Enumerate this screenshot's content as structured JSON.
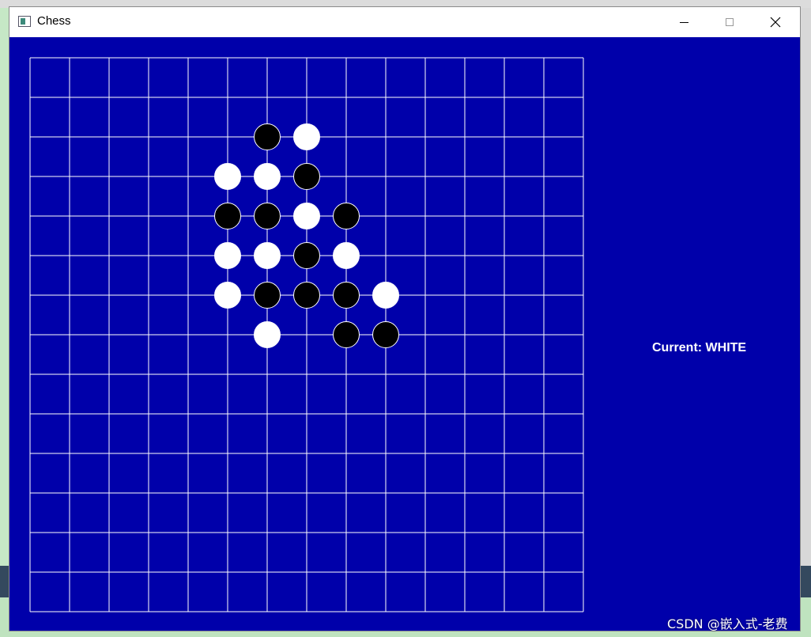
{
  "window": {
    "title": "Chess",
    "icon": "app-window-icon",
    "controls": {
      "minimize_icon": "minimize-icon",
      "maximize_icon": "maximize-icon",
      "close_icon": "close-icon"
    }
  },
  "colors": {
    "board_background": "#0000AA",
    "grid_line": "#FFFFFF",
    "black_stone": "#000000",
    "white_stone": "#FFFFFF"
  },
  "board": {
    "columns": 15,
    "rows": 15,
    "stones": [
      {
        "col": 6,
        "row": 2,
        "color": "black"
      },
      {
        "col": 7,
        "row": 2,
        "color": "white"
      },
      {
        "col": 5,
        "row": 3,
        "color": "white"
      },
      {
        "col": 6,
        "row": 3,
        "color": "white"
      },
      {
        "col": 7,
        "row": 3,
        "color": "black"
      },
      {
        "col": 5,
        "row": 4,
        "color": "black"
      },
      {
        "col": 6,
        "row": 4,
        "color": "black"
      },
      {
        "col": 7,
        "row": 4,
        "color": "white"
      },
      {
        "col": 8,
        "row": 4,
        "color": "black"
      },
      {
        "col": 5,
        "row": 5,
        "color": "white"
      },
      {
        "col": 6,
        "row": 5,
        "color": "white"
      },
      {
        "col": 7,
        "row": 5,
        "color": "black"
      },
      {
        "col": 8,
        "row": 5,
        "color": "white"
      },
      {
        "col": 5,
        "row": 6,
        "color": "white"
      },
      {
        "col": 6,
        "row": 6,
        "color": "black"
      },
      {
        "col": 7,
        "row": 6,
        "color": "black"
      },
      {
        "col": 8,
        "row": 6,
        "color": "black"
      },
      {
        "col": 9,
        "row": 6,
        "color": "white"
      },
      {
        "col": 6,
        "row": 7,
        "color": "white"
      },
      {
        "col": 8,
        "row": 7,
        "color": "black"
      },
      {
        "col": 9,
        "row": 7,
        "color": "black"
      }
    ]
  },
  "status": {
    "current_player_text": "Current: WHITE"
  },
  "watermark": "CSDN @嵌入式-老费"
}
